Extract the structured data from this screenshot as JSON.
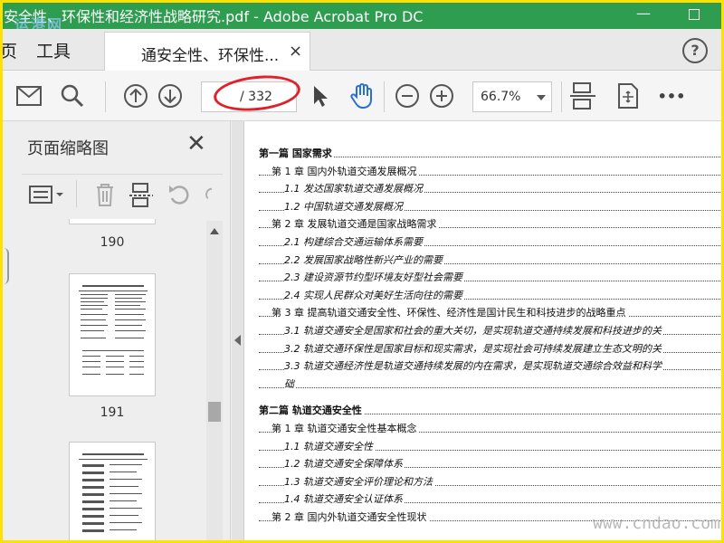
{
  "window": {
    "title": "安全性、环保性和经济性战略研究.pdf - Adobe Acrobat Pro DC",
    "watermark_top": "运港网",
    "min_symbol": "—"
  },
  "tabs": {
    "home": "页",
    "tools": "工具",
    "doc_label": "通安全性、环保性...",
    "close": "×",
    "help": "?"
  },
  "toolbar": {
    "page_current": "",
    "page_total": "/ 332",
    "zoom": "66.7%",
    "more": "•••"
  },
  "thumbnails": {
    "title": "页面缩略图",
    "close": "✕",
    "pages": [
      "190",
      "191"
    ]
  },
  "toc": [
    {
      "level": 0,
      "text": "第一篇  国家需求"
    },
    {
      "level": 1,
      "text": "第 1 章  国内外轨道交通发展概况"
    },
    {
      "level": 2,
      "text": "1.1  发达国家轨道交通发展概况"
    },
    {
      "level": 2,
      "text": "1.2  中国轨道交通发展概况"
    },
    {
      "level": 1,
      "text": "第 2 章  发展轨道交通是国家战略需求"
    },
    {
      "level": 2,
      "text": "2.1  构建综合交通运输体系需要"
    },
    {
      "level": 2,
      "text": "2.2  发展国家战略性新兴产业的需要"
    },
    {
      "level": 2,
      "text": "2.3  建设资源节约型环境友好型社会需要"
    },
    {
      "level": 2,
      "text": "2.4  实现人民群众对美好生活向往的需要"
    },
    {
      "level": 1,
      "text": "第 3 章  提高轨道交通安全性、环保性、经济性是国计民生和科技进步的战略重点"
    },
    {
      "level": 2,
      "text": "3.1  轨道交通安全是国家和社会的重大关切，是实现轨道交通持续发展和科技进步的关"
    },
    {
      "level": 2,
      "text": "3.2  轨道交通环保性是国家目标和现实需求，是实现社会可持续发展建立生态文明的关"
    },
    {
      "level": 2,
      "text": "3.3  轨道交通经济性是轨道交通持续发展的内在需求，是实现轨道交通综合效益和科学"
    },
    {
      "level": 3,
      "text": "础"
    },
    {
      "level": -1,
      "text": ""
    },
    {
      "level": 0,
      "text": "第二篇  轨道交通安全性"
    },
    {
      "level": 1,
      "text": "第 1 章  轨道交通安全性基本概念"
    },
    {
      "level": 2,
      "text": "1.1  轨道交通安全性"
    },
    {
      "level": 2,
      "text": "1.2  轨道交通安全保障体系"
    },
    {
      "level": 2,
      "text": "1.3  轨道交通安全评价理论和方法"
    },
    {
      "level": 2,
      "text": "1.4  轨道交通安全认证体系"
    },
    {
      "level": 1,
      "text": "第 2 章  国内外轨道交通安全性现状"
    }
  ],
  "watermark_bottom": "www.cndao.com"
}
